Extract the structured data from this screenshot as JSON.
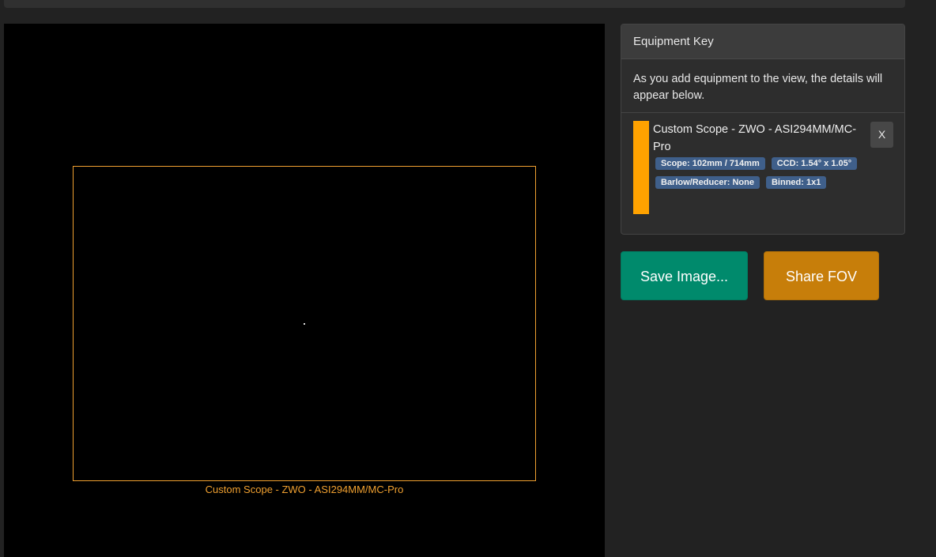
{
  "fov": {
    "label": "Custom Scope - ZWO - ASI294MM/MC-Pro",
    "outline_color": "#f0a030"
  },
  "equipment_key": {
    "title": "Equipment Key",
    "intro": "As you add equipment to the view, the details will appear below.",
    "items": [
      {
        "name": "Custom Scope - ZWO - ASI294MM/MC-Pro",
        "color": "#ffa200",
        "badges": [
          "Scope: 102mm / 714mm",
          "CCD: 1.54° x 1.05°",
          "Barlow/Reducer: None",
          "Binned: 1x1"
        ],
        "remove_label": "X"
      }
    ]
  },
  "actions": {
    "save_label": "Save Image...",
    "share_label": "Share FOV"
  },
  "colors": {
    "save": "#008a6c",
    "share": "#c77e0a",
    "badge": "#3f5f8a"
  }
}
